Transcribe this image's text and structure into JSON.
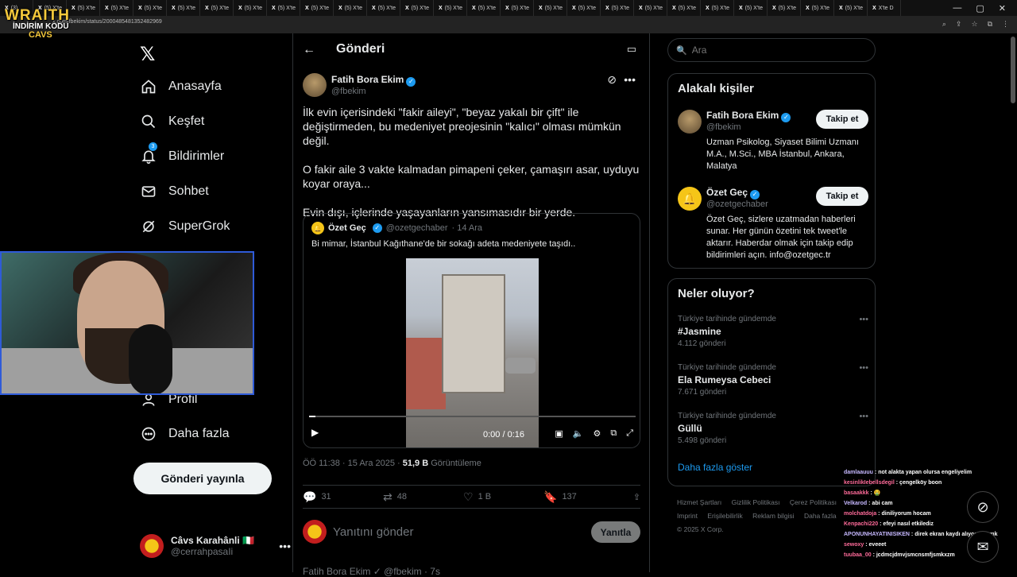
{
  "browser": {
    "tabs": [
      "(3)",
      "(5) X'te",
      "(5) X'te",
      "(5) X'te",
      "(5) X'te",
      "(5) X'te",
      "(5) X'te",
      "(5) X'te",
      "(5) X'te",
      "(5) X'te",
      "(5) X'te",
      "(5) X'te",
      "(5) X'te",
      "(5) X'te",
      "(5) X'te",
      "(5) X'te",
      "(5) X'te",
      "(5) X'te",
      "(5) X'te",
      "(5) X'te",
      "(5) X'te",
      "(5) X'te",
      "(5) X'te",
      "(5) X'te",
      "(5) X'te",
      "(5) X'te",
      "X'te D"
    ],
    "url": "x.com/fbekim/status/2000485481352482969",
    "controls": [
      "—",
      "▢",
      "✕"
    ]
  },
  "overlay": {
    "line1": "WRAITH",
    "line2": "İNDİRİM KODU",
    "line3": "CAVS"
  },
  "nav": {
    "items": [
      {
        "label": "Anasayfa",
        "icon": "home-icon"
      },
      {
        "label": "Keşfet",
        "icon": "search-icon"
      },
      {
        "label": "Bildirimler",
        "icon": "bell-icon",
        "badge": "3"
      },
      {
        "label": "Sohbet",
        "icon": "mail-icon"
      },
      {
        "label": "SuperGrok",
        "icon": "grok-icon"
      },
      {
        "label": "Profil",
        "icon": "person-icon"
      },
      {
        "label": "Daha fazla",
        "icon": "more-circle-icon"
      }
    ],
    "post_button": "Gönderi yayınla",
    "account": {
      "name": "Câvs Karahânli 🇮🇹",
      "handle": "@cerrahpasaIi"
    }
  },
  "main": {
    "title": "Gönderi",
    "tweet": {
      "name": "Fatih Bora Ekim",
      "handle": "@fbekim",
      "text1": "İlk evin içerisindeki \"fakir aileyi\", \"beyaz yakalı bir çift\" ile değiştirmeden, bu medeniyet preojesinin \"kalıcı\" olması mümkün değil.",
      "text2": "O fakir aile 3 vakte kalmadan pimapeni çeker, çamaşırı asar, uyduyu koyar oraya...",
      "text3": "Evin dışı, içlerinde yaşayanların yansımasıdır bir yerde.",
      "quote": {
        "name": "Özet Geç",
        "handle": "@ozetgechaber",
        "date": "· 14 Ara",
        "text": "Bi mimar, İstanbul Kağıthane'de bir sokağı adeta medeniyete taşıdı..",
        "video_time": "0:00 / 0:16",
        "progress": 0.02
      },
      "time": "ÖÖ 11:38 · 15 Ara 2025 ·",
      "views": "51,9 B",
      "views_label": "Görüntüleme",
      "stats": {
        "replies": "31",
        "reposts": "48",
        "likes": "1 B",
        "bookmarks": "137"
      }
    },
    "reply_placeholder": "Yanıtını gönder",
    "reply_button": "Yanıtla",
    "next_preview": "Fatih Bora Ekim ✓ @fbekim · 7s"
  },
  "right": {
    "search_placeholder": "Ara",
    "related_title": "Alakalı kişiler",
    "people": [
      {
        "name": "Fatih Bora Ekim",
        "handle": "@fbekim",
        "bio": "Uzman Psikolog, Siyaset Bilimi Uzmanı M.A., M.Sci., MBA İstanbul, Ankara, Malatya",
        "follow": "Takip et"
      },
      {
        "name": "Özet Geç",
        "handle": "@ozetgechaber",
        "bio": "Özet Geç, sizlere uzatmadan haberleri sunar. Her günün özetini tek tweet'le aktarır. Haberdar olmak için takip edip bildirimleri açın. info@ozetgec.tr",
        "follow": "Takip et"
      }
    ],
    "trends_title": "Neler oluyor?",
    "trends": [
      {
        "category": "Türkiye tarihinde gündemde",
        "name": "#Jasmine",
        "count": "4.112 gönderi"
      },
      {
        "category": "Türkiye tarihinde gündemde",
        "name": "Ela Rumeysa Cebeci",
        "count": "7.671 gönderi"
      },
      {
        "category": "Türkiye tarihinde gündemde",
        "name": "Güllü",
        "count": "5.498 gönderi"
      }
    ],
    "show_more": "Daha fazla göster",
    "footer": [
      "Hizmet Şartları",
      "Gizlilik Politikası",
      "Çerez Politikası",
      "Imprint",
      "Erişilebilirlik",
      "Reklam bilgisi",
      "Daha fazla",
      "© 2025 X Corp."
    ]
  },
  "chat": [
    {
      "user": "damlaauuu",
      "msg": "not alakta yapan olursa engeliyelim"
    },
    {
      "user": "kesinlikIebellsdegil",
      "msg": "çengelköy boon"
    },
    {
      "user": "basaakkk",
      "msg": "🤮"
    },
    {
      "user": "Velkarod",
      "msg": "abi cam"
    },
    {
      "user": "molchatdoja",
      "msg": "diniliyorum hocam"
    },
    {
      "user": "Kenpachi220",
      "msg": "efeyi nasıl etkilediz"
    },
    {
      "user": "APONUNHAYATINISIKEN",
      "msg": "direk ekran kaydı alıyorum amk"
    },
    {
      "user": "sewoxy",
      "msg": "eveeet"
    },
    {
      "user": "tuubaa_00",
      "msg": "jcdmcjdmvjsmcnsmfjsmkxzm"
    }
  ]
}
